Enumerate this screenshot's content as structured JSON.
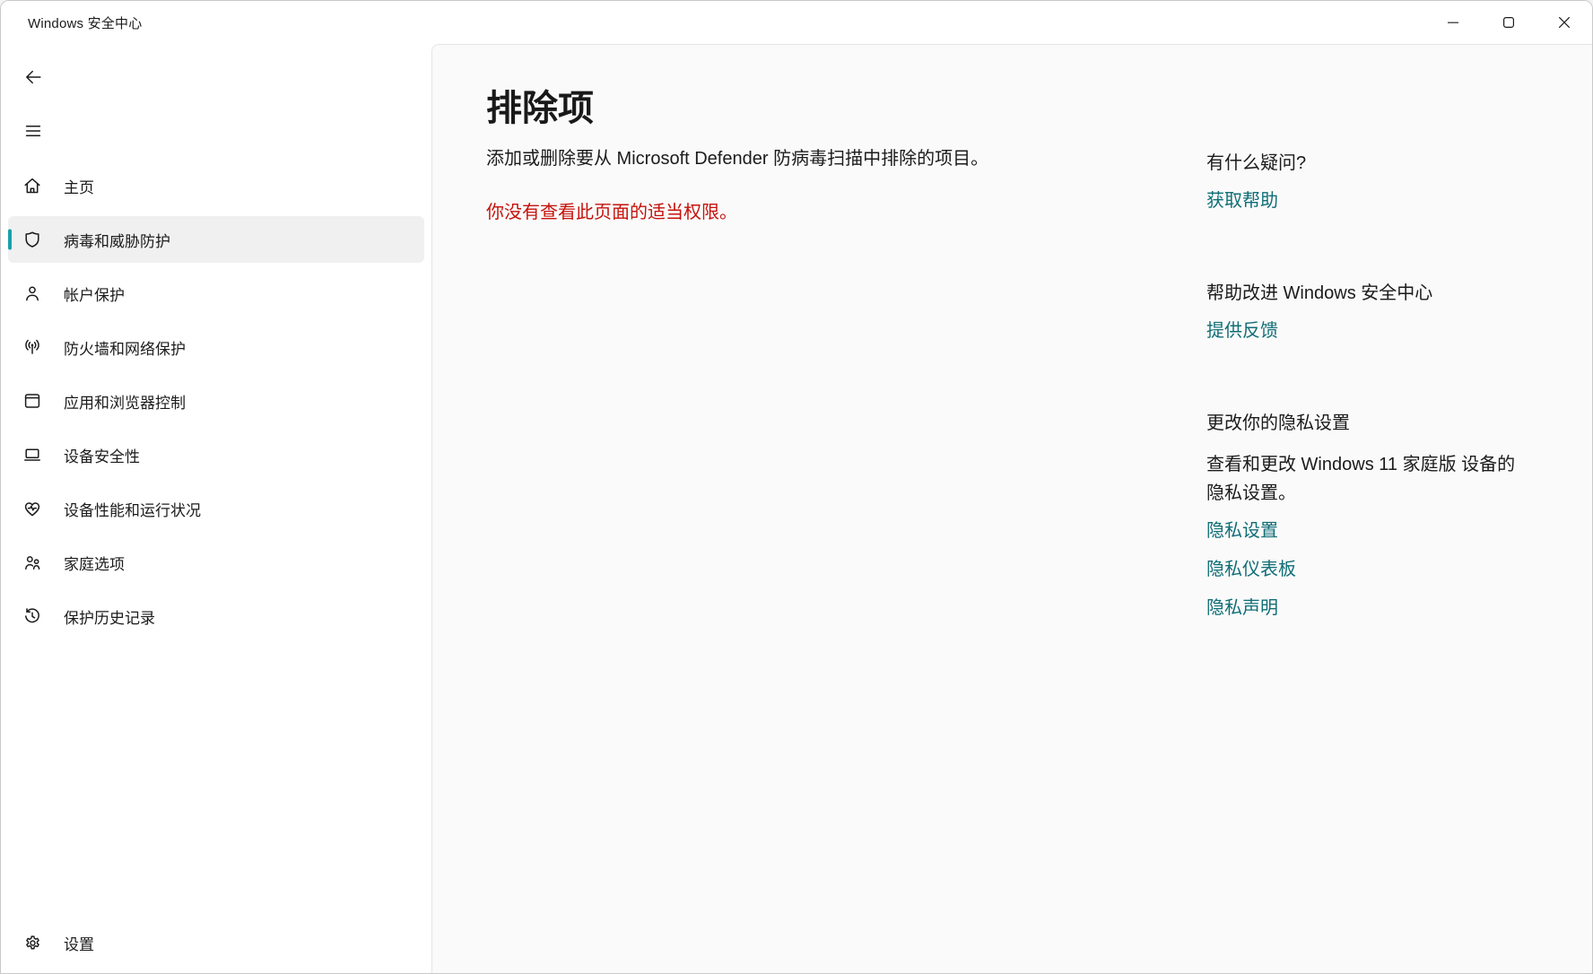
{
  "window": {
    "title": "Windows 安全中心",
    "controls": {
      "minimize": "minimize",
      "maximize": "maximize",
      "close": "close"
    }
  },
  "sidebar": {
    "items": [
      {
        "label": "主页",
        "icon": "home-icon",
        "selected": false
      },
      {
        "label": "病毒和威胁防护",
        "icon": "shield-icon",
        "selected": true
      },
      {
        "label": "帐户保护",
        "icon": "person-icon",
        "selected": false
      },
      {
        "label": "防火墙和网络保护",
        "icon": "network-icon",
        "selected": false
      },
      {
        "label": "应用和浏览器控制",
        "icon": "browser-icon",
        "selected": false
      },
      {
        "label": "设备安全性",
        "icon": "laptop-icon",
        "selected": false
      },
      {
        "label": "设备性能和运行状况",
        "icon": "health-icon",
        "selected": false
      },
      {
        "label": "家庭选项",
        "icon": "family-icon",
        "selected": false
      },
      {
        "label": "保护历史记录",
        "icon": "history-icon",
        "selected": false
      }
    ],
    "settings_label": "设置"
  },
  "main": {
    "title": "排除项",
    "description": "添加或删除要从 Microsoft Defender 防病毒扫描中排除的项目。",
    "error": "你没有查看此页面的适当权限。"
  },
  "aside": {
    "help": {
      "heading": "有什么疑问?",
      "link": "获取帮助"
    },
    "feedback": {
      "heading": "帮助改进 Windows 安全中心",
      "link": "提供反馈"
    },
    "privacy": {
      "heading": "更改你的隐私设置",
      "body": "查看和更改 Windows 11 家庭版 设备的隐私设置。",
      "links": [
        "隐私设置",
        "隐私仪表板",
        "隐私声明"
      ]
    }
  },
  "colors": {
    "accent": "#1aa0aa",
    "link": "#106e76",
    "error": "#c5120b",
    "selected_item_bg": "#f0f0f0",
    "pane_bg": "#fafafa"
  }
}
